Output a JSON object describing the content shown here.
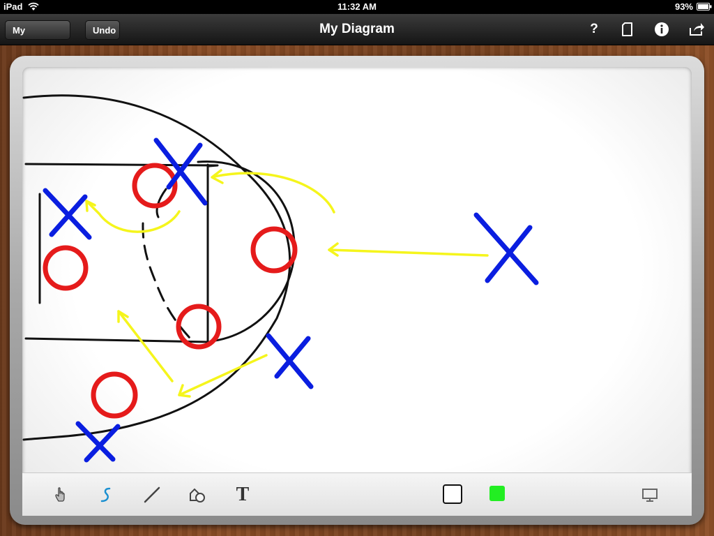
{
  "status_bar": {
    "carrier": "iPad",
    "time": "11:32 AM",
    "battery": "93%"
  },
  "nav_bar": {
    "left_buttons": {
      "my_diagrams": "My Diagrams",
      "undo": "Undo"
    },
    "title": "My Diagram",
    "right_icons": [
      "help-icon",
      "page-icon",
      "info-icon",
      "share-icon"
    ],
    "help_label": "?"
  },
  "board": {
    "stroke_colors": {
      "court": "#111111",
      "offense": "#e51b1b",
      "defense": "#0a1ee0",
      "movement": "#f5f51c"
    }
  },
  "toolbar": {
    "tools": [
      "hand-icon",
      "freehand-pen-icon",
      "line-icon",
      "shapes-icon",
      "text-icon"
    ],
    "selected_tool": "freehand-pen-icon",
    "text_tool_label": "T",
    "stroke_color_swatch": "#ffffff",
    "fill_color_swatch": "#22ee22",
    "right_tool": "presentation-screen-icon"
  }
}
